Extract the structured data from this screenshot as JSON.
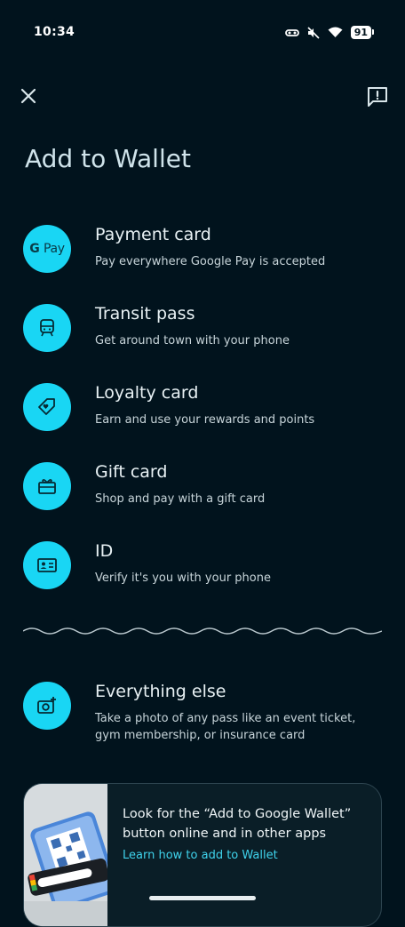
{
  "status_bar": {
    "time": "10:34",
    "battery": "91",
    "icons": [
      "link-icon",
      "mute-icon",
      "wifi-icon",
      "battery-icon"
    ]
  },
  "header": {
    "close_icon": "close-icon",
    "feedback_icon": "feedback-icon"
  },
  "page": {
    "title": "Add to Wallet"
  },
  "options": [
    {
      "title": "Payment card",
      "subtitle": "Pay everywhere Google Pay is accepted",
      "icon": "google-pay-icon",
      "icon_text_g": "G",
      "icon_text_pay": "Pay"
    },
    {
      "title": "Transit pass",
      "subtitle": "Get around town with your phone",
      "icon": "train-icon"
    },
    {
      "title": "Loyalty card",
      "subtitle": "Earn and use your rewards and points",
      "icon": "tag-heart-icon"
    },
    {
      "title": "Gift card",
      "subtitle": "Shop and pay with a gift card",
      "icon": "gift-card-icon"
    },
    {
      "title": "ID",
      "subtitle": "Verify it's you with your phone",
      "icon": "id-card-icon"
    }
  ],
  "everything_else": {
    "title": "Everything else",
    "subtitle": "Take a photo of any pass like an event ticket, gym membership, or insurance card",
    "icon": "add-photo-icon"
  },
  "promo": {
    "text": "Look for the “Add to Google Wallet” button online and in other apps",
    "link": "Learn how to add to Wallet"
  },
  "colors": {
    "background": "#01131d",
    "accent": "#19d6f4",
    "link": "#3fd3ec"
  }
}
